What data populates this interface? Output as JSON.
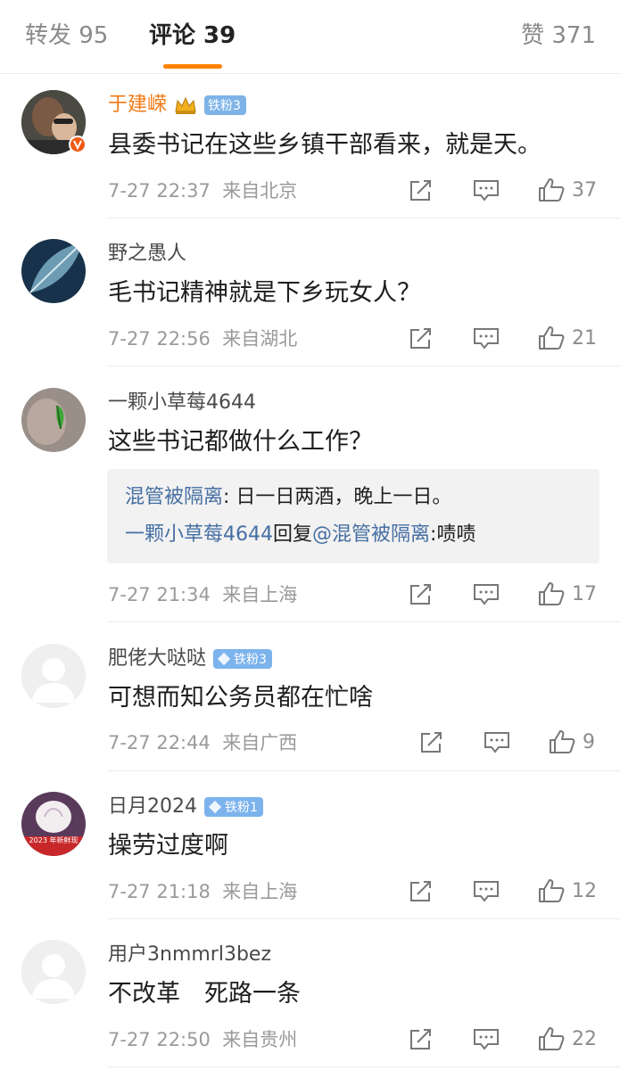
{
  "tabs": {
    "repost": "转发 95",
    "comment": "评论 39",
    "like": "赞 371"
  },
  "comments": [
    {
      "name": "于建嵘",
      "badge": "铁粉3",
      "text": "县委书记在这些乡镇干部看来，就是天。",
      "time": "7-27 22:37",
      "location": "来自北京",
      "likes": "37"
    },
    {
      "name": "野之愚人",
      "text": "毛书记精神就是下乡玩女人？",
      "time": "7-27 22:56",
      "location": "来自湖北",
      "likes": "21"
    },
    {
      "name": "一颗小草莓4644",
      "text": "这些书记都做什么工作？",
      "time": "7-27 21:34",
      "location": "来自上海",
      "likes": "17",
      "replies": [
        {
          "author": "混管被隔离",
          "sep": ": ",
          "content": "日一日两酒，晚上一日。"
        },
        {
          "author": "一颗小草莓4644",
          "mid": "回复",
          "mention": "@混管被隔离",
          "sep": ":",
          "content": "啧啧"
        }
      ]
    },
    {
      "name": "肥佬大哒哒",
      "badge": "铁粉3",
      "text": "可想而知公务员都在忙啥",
      "time": "7-27 22:44",
      "location": "来自广西",
      "likes": "9"
    },
    {
      "name": "日月2024",
      "badge": "铁粉1",
      "text": "操劳过度啊",
      "time": "7-27 21:18",
      "location": "来自上海",
      "likes": "12",
      "avatar_caption": "2023 年新鲜现"
    },
    {
      "name": "用户3nmmrl3bez",
      "text": "不改革　死路一条",
      "time": "7-27 22:50",
      "location": "来自贵州",
      "likes": "22"
    }
  ],
  "colors": {
    "accent": "#ff8200",
    "vip_name": "#f07a14",
    "link": "#456fa3",
    "badge": "#7cb3ec",
    "verified": "#f05a14"
  }
}
